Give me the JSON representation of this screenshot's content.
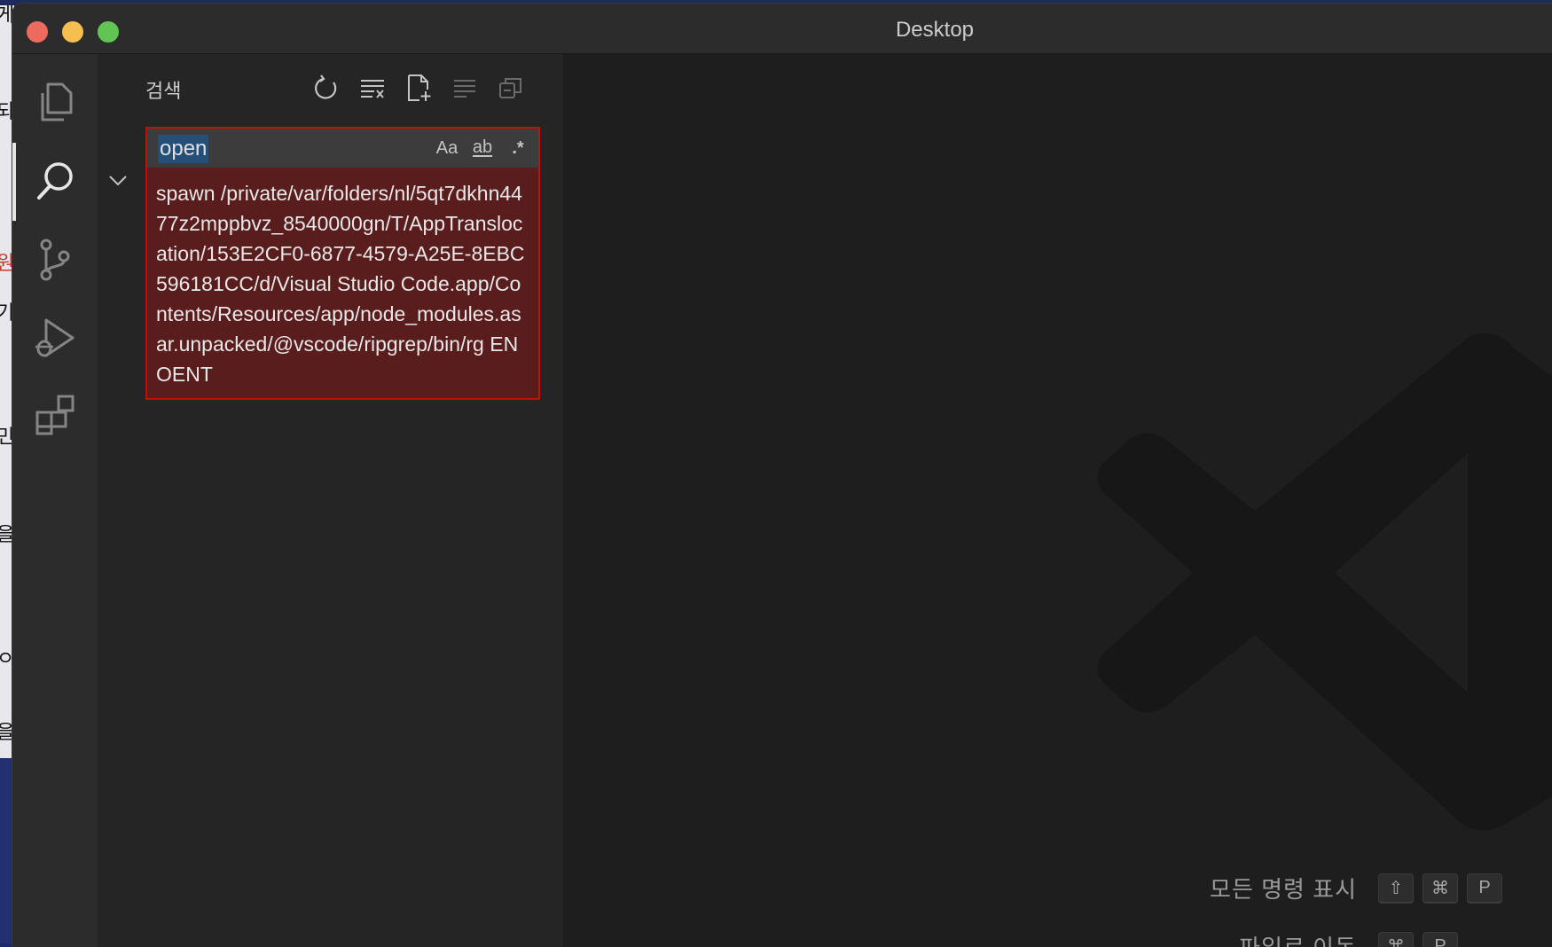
{
  "window": {
    "title": "Desktop"
  },
  "background_fragments": [
    {
      "text": "게",
      "color": "#111111"
    },
    {
      "text": "되",
      "color": "#111111"
    },
    {
      "text": "원",
      "color": "#c43a2f"
    },
    {
      "text": "기",
      "color": "#111111"
    },
    {
      "text": "민",
      "color": "#111111"
    },
    {
      "text": "을",
      "color": "#111111"
    },
    {
      "text": "ㅇ",
      "color": "#111111"
    },
    {
      "text": "을",
      "color": "#111111"
    }
  ],
  "activity_bar": {
    "items": [
      {
        "name": "explorer",
        "icon": "files-icon",
        "active": false
      },
      {
        "name": "search",
        "icon": "search-icon",
        "active": true
      },
      {
        "name": "source-control",
        "icon": "source-control-icon",
        "active": false
      },
      {
        "name": "run-debug",
        "icon": "run-debug-icon",
        "active": false
      },
      {
        "name": "extensions",
        "icon": "extensions-icon",
        "active": false
      }
    ]
  },
  "sidebar": {
    "title": "검색",
    "actions": [
      {
        "name": "refresh",
        "icon": "refresh-icon"
      },
      {
        "name": "clear-results",
        "icon": "clear-all-icon"
      },
      {
        "name": "new-search-editor",
        "icon": "new-file-icon"
      },
      {
        "name": "view-as-tree",
        "icon": "list-icon"
      },
      {
        "name": "collapse-all",
        "icon": "collapse-all-icon"
      }
    ],
    "search": {
      "value": "open",
      "options": {
        "match_case": "Aa",
        "whole_word": "ab",
        "regex": ".*"
      }
    },
    "error_message": "spawn /private/var/folders/nl/5qt7dkhn4477z2mppbvz_8540000gn/T/AppTranslocation/153E2CF0-6877-4579-A25E-8EBC596181CC/d/Visual Studio Code.app/Contents/Resources/app/node_modules.asar.unpacked/@vscode/ripgrep/bin/rg ENOENT"
  },
  "editor": {
    "shortcuts": [
      {
        "label": "모든 명령 표시",
        "keys": [
          "⇧",
          "⌘",
          "P"
        ]
      },
      {
        "label": "파일로 이동",
        "keys": [
          "⌘",
          "P"
        ]
      }
    ]
  },
  "colors": {
    "accent_error_border": "#be1100",
    "error_background": "#5a1d1d",
    "selection": "#264f78"
  }
}
